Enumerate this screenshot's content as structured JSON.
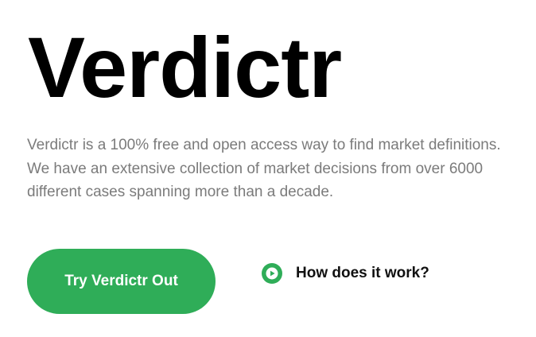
{
  "hero": {
    "title": "Verdictr",
    "description": "Verdictr is a 100% free and open access way to find market definitions. We have an extensive collection of market decisions from over 6000 different cases spanning more than a decade.",
    "cta_label": "Try Verdictr Out",
    "how_label": "How does it work?"
  },
  "icons": {
    "play": "play-circle-icon"
  },
  "colors": {
    "accent": "#2fad58",
    "title": "#000000",
    "description": "#7b7b7b",
    "link": "#111111"
  }
}
